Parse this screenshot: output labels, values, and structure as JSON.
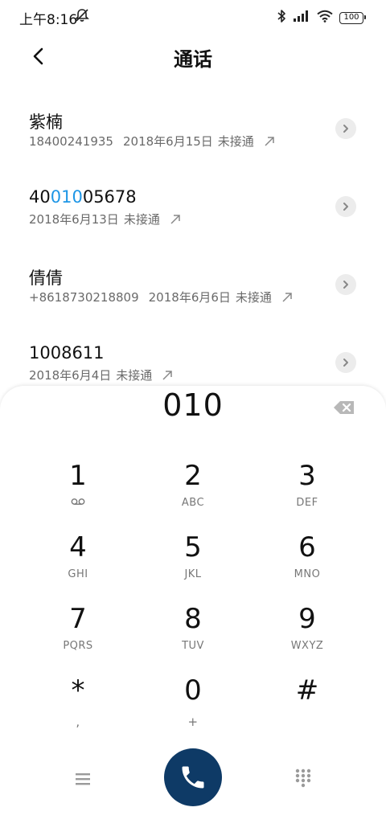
{
  "status_bar": {
    "time": "上午8:16",
    "battery": "100"
  },
  "header": {
    "title": "通话"
  },
  "results": [
    {
      "name_parts": [
        "紫楠",
        "",
        ""
      ],
      "number": "18400241935",
      "date": "2018年6月15日",
      "status": "未接通"
    },
    {
      "name_parts": [
        "40",
        "010",
        "05678"
      ],
      "number": "",
      "date": "2018年6月13日",
      "status": "未接通"
    },
    {
      "name_parts": [
        "倩倩",
        "",
        ""
      ],
      "number": "+8618730218809",
      "date": "2018年6月6日",
      "status": "未接通"
    },
    {
      "name_parts": [
        "1008611",
        "",
        ""
      ],
      "number": "",
      "date": "2018年6月4日",
      "status": "未接通"
    }
  ],
  "dialpad": {
    "input": "010",
    "keys": [
      {
        "digit": "1",
        "letters": ""
      },
      {
        "digit": "2",
        "letters": "ABC"
      },
      {
        "digit": "3",
        "letters": "DEF"
      },
      {
        "digit": "4",
        "letters": "GHI"
      },
      {
        "digit": "5",
        "letters": "JKL"
      },
      {
        "digit": "6",
        "letters": "MNO"
      },
      {
        "digit": "7",
        "letters": "PQRS"
      },
      {
        "digit": "8",
        "letters": "TUV"
      },
      {
        "digit": "9",
        "letters": "WXYZ"
      },
      {
        "digit": "*",
        "letters": ","
      },
      {
        "digit": "0",
        "letters": "+"
      },
      {
        "digit": "#",
        "letters": ""
      }
    ],
    "key_icons": {
      "1": "voicemail-icon"
    }
  },
  "colors": {
    "highlight": "#1e96e6",
    "call_button": "#0e3a66"
  }
}
